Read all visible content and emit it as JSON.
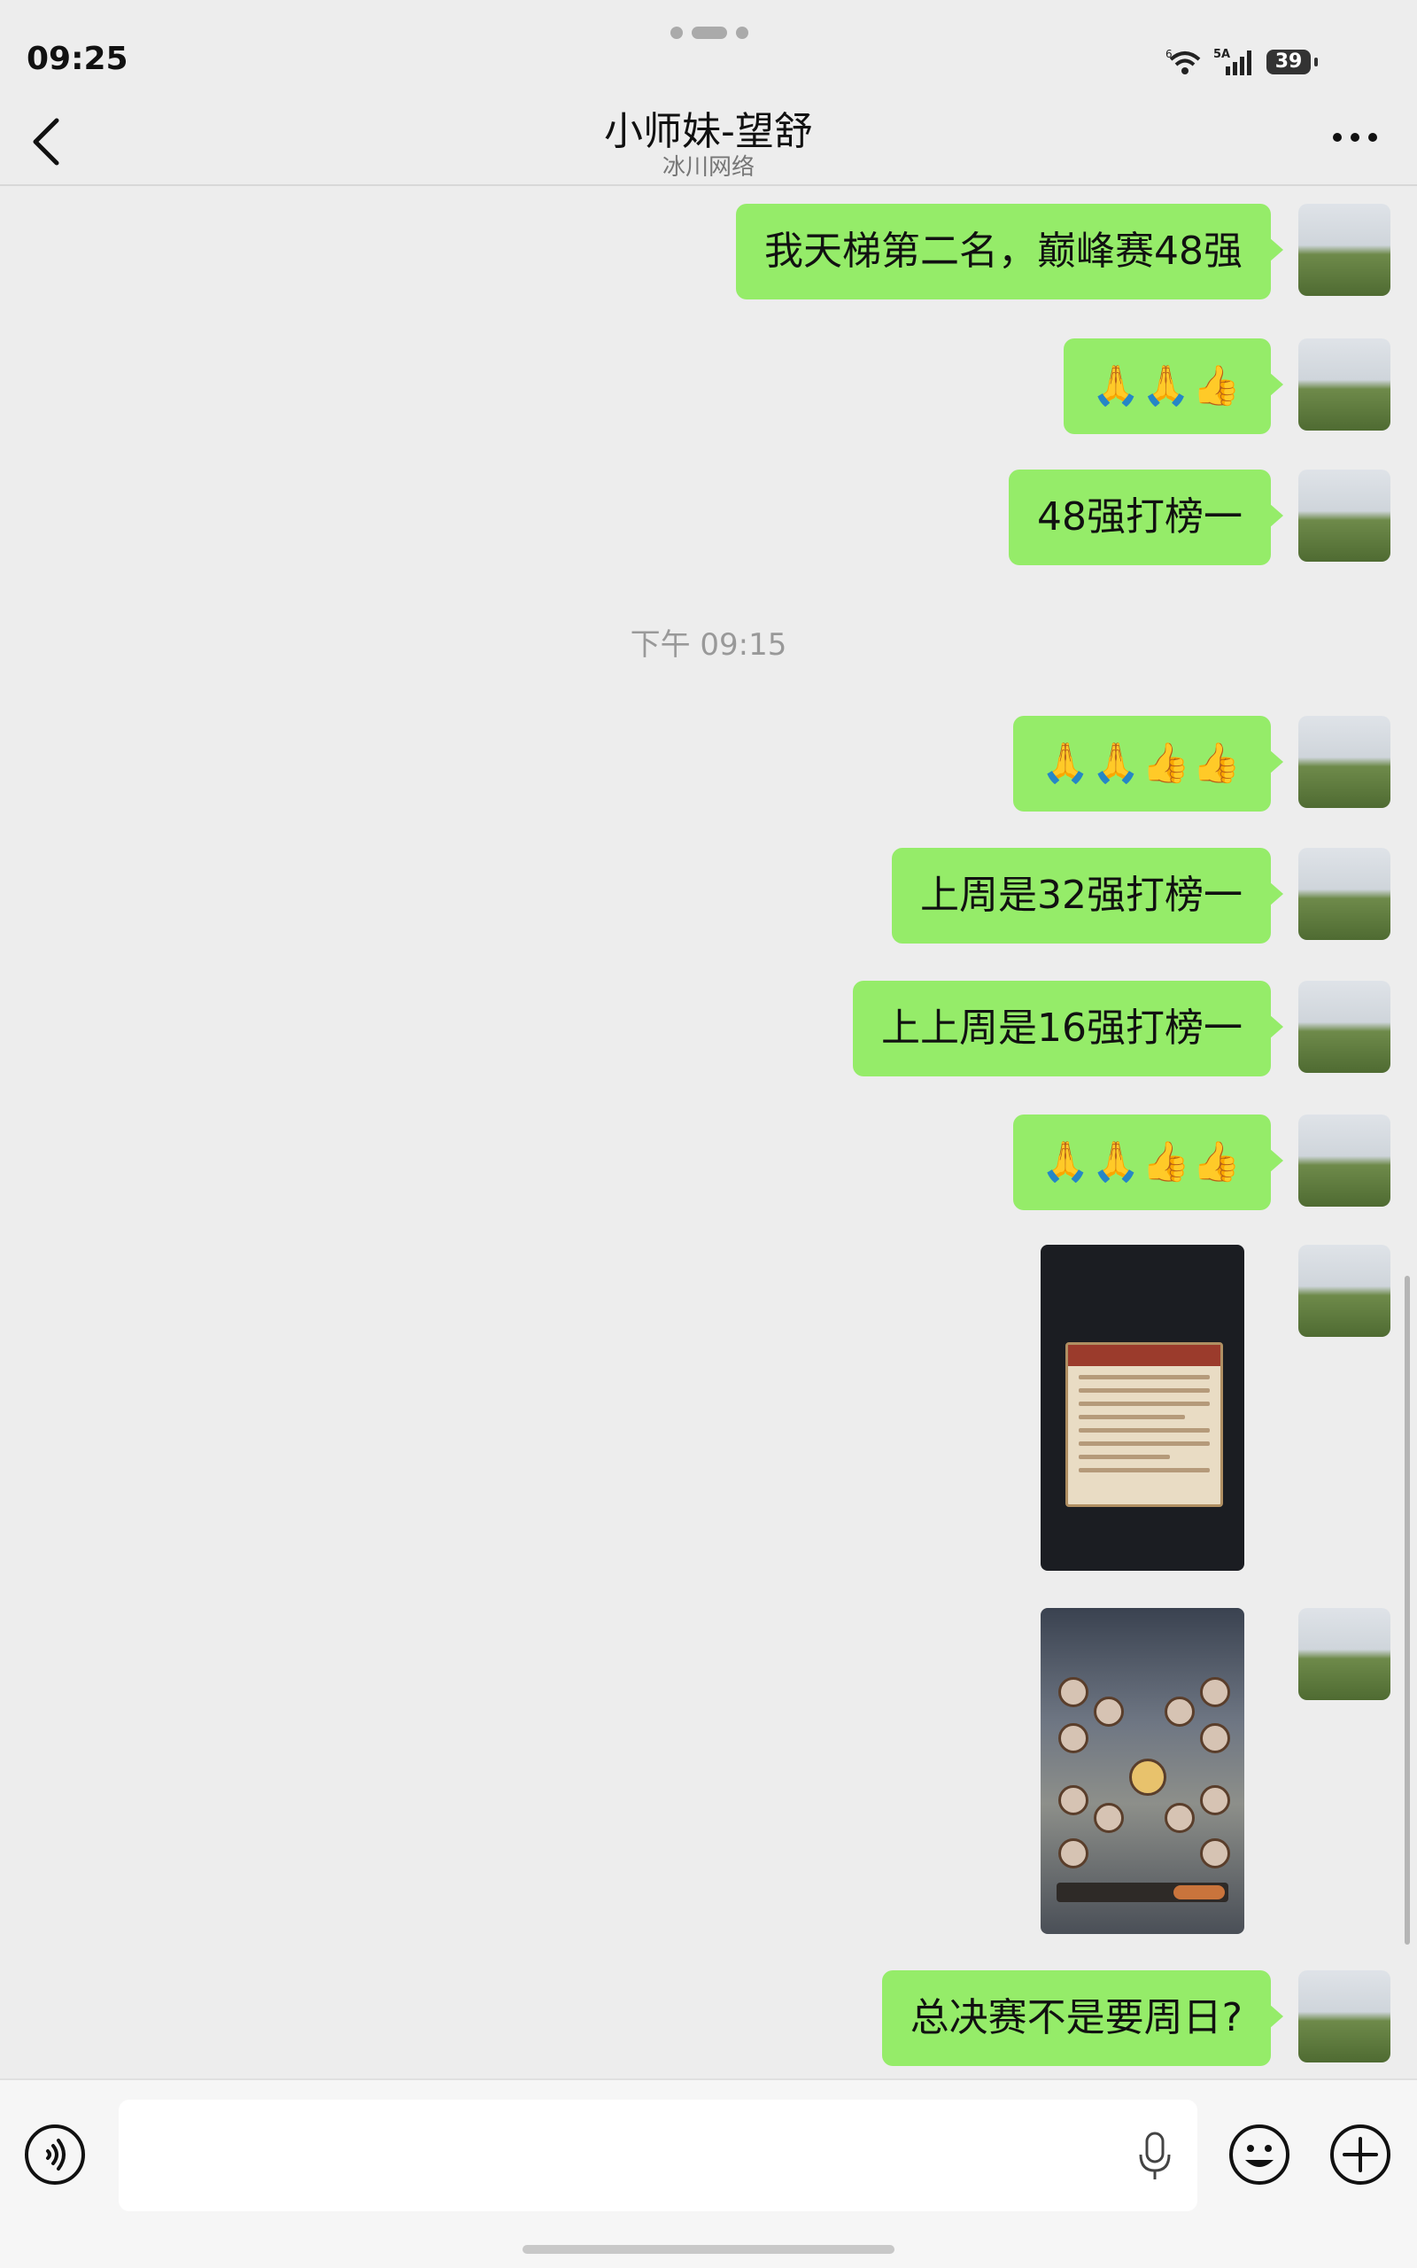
{
  "status_bar": {
    "time": "09:25",
    "network": "5A",
    "wifi_badge": "6",
    "battery": "39"
  },
  "header": {
    "title": "小师妹-望舒",
    "subtitle": "冰川网络"
  },
  "messages": [
    {
      "type": "text",
      "text": "我天梯第二名，巅峰赛48强"
    },
    {
      "type": "emoji",
      "text": "🙏🙏👍"
    },
    {
      "type": "text",
      "text": "48强打榜一"
    },
    {
      "type": "timestamp",
      "text": "下午 09:15"
    },
    {
      "type": "emoji",
      "text": "🙏🙏👍👍"
    },
    {
      "type": "text",
      "text": "上周是32强打榜一"
    },
    {
      "type": "text",
      "text": "上上周是16强打榜一"
    },
    {
      "type": "emoji",
      "text": "🙏🙏👍👍"
    },
    {
      "type": "image",
      "description": "game-rules-screenshot"
    },
    {
      "type": "image",
      "description": "game-bracket-screenshot"
    },
    {
      "type": "text",
      "text": "总决赛不是要周日?"
    }
  ],
  "input": {
    "placeholder": "",
    "value": ""
  },
  "colors": {
    "bubble": "#95ec69",
    "background": "#ededed"
  }
}
